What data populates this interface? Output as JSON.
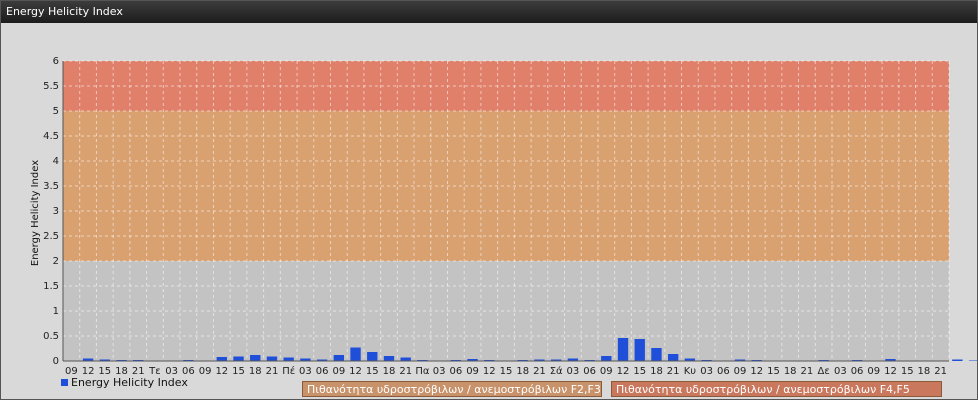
{
  "window": {
    "title": "Energy Helicity Index"
  },
  "chart_data": {
    "type": "bar",
    "ylabel": "Energy Helicity Index",
    "ylim": [
      0,
      6
    ],
    "yticks": [
      "0",
      "0.5",
      "1",
      "1.5",
      "2",
      "2.5",
      "3",
      "3.5",
      "4",
      "4.5",
      "5",
      "5.5",
      "6"
    ],
    "categories": [
      "09",
      "12",
      "15",
      "18",
      "21",
      "Τε",
      "03",
      "06",
      "09",
      "12",
      "15",
      "18",
      "21",
      "Πέ",
      "03",
      "06",
      "09",
      "12",
      "15",
      "18",
      "21",
      "Πα",
      "03",
      "06",
      "09",
      "12",
      "15",
      "18",
      "21",
      "Σά",
      "03",
      "06",
      "09",
      "12",
      "15",
      "18",
      "21",
      "Κυ",
      "03",
      "06",
      "09",
      "12",
      "15",
      "18",
      "21",
      "Δε",
      "03",
      "06",
      "09",
      "12",
      "15",
      "18",
      "21"
    ],
    "series": [
      {
        "name": "Energy Helicity Index",
        "values": [
          0.01,
          0.05,
          0.03,
          0.02,
          0.02,
          0.01,
          0.01,
          0.02,
          0.01,
          0.08,
          0.09,
          0.12,
          0.09,
          0.07,
          0.05,
          0.03,
          0.12,
          0.27,
          0.18,
          0.1,
          0.07,
          0.02,
          0.01,
          0.02,
          0.04,
          0.02,
          0.01,
          0.02,
          0.03,
          0.03,
          0.05,
          0.02,
          0.1,
          0.46,
          0.44,
          0.26,
          0.14,
          0.05,
          0.02,
          0.01,
          0.03,
          0.02,
          0.01,
          0.01,
          0.01,
          0.02,
          0.01,
          0.02,
          0.01,
          0.04,
          0.01,
          0.01,
          0.01,
          0.03,
          0.01,
          0.02,
          0.02
        ]
      }
    ],
    "bands": [
      {
        "from": 2,
        "to": 5,
        "color": "#d9a070",
        "label": "Πιθανότητα υδροστρόβιλων / ανεμοστρόβιλων F2,F3"
      },
      {
        "from": 5,
        "to": 6,
        "color": "#e0806a",
        "label": "Πιθανότητα υδροστρόβιλων / ανεμοστρόβιλων F4,F5"
      }
    ],
    "bar_color": "#1f4fd8",
    "grid": true,
    "legend": "bottom-left"
  }
}
